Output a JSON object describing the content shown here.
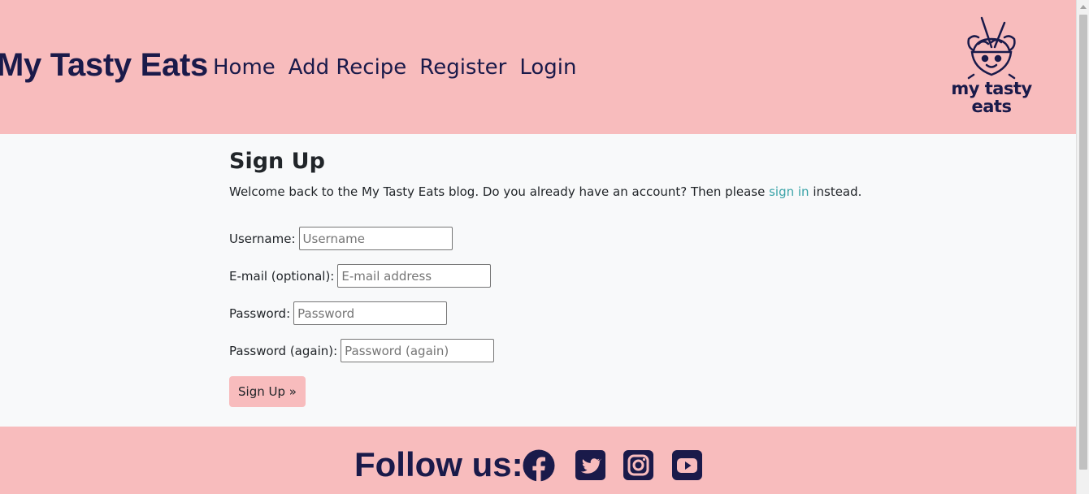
{
  "header": {
    "brand": "My Tasty Eats",
    "nav": [
      "Home",
      "Add Recipe",
      "Register",
      "Login"
    ],
    "logo_text_line1": "my tasty",
    "logo_text_line2": "eats"
  },
  "main": {
    "title": "Sign Up",
    "intro_before": "Welcome back to the My Tasty Eats blog. Do you already have an account? Then please ",
    "intro_link": "sign in",
    "intro_after": " instead.",
    "fields": [
      {
        "label": "Username:",
        "placeholder": "Username",
        "value": ""
      },
      {
        "label": "E-mail (optional):",
        "placeholder": "E-mail address",
        "value": ""
      },
      {
        "label": "Password:",
        "placeholder": "Password",
        "value": ""
      },
      {
        "label": "Password (again):",
        "placeholder": "Password (again)",
        "value": ""
      }
    ],
    "submit_label": "Sign Up »"
  },
  "footer": {
    "follow_text": "Follow us:",
    "icons": [
      "facebook-icon",
      "twitter-icon",
      "instagram-icon",
      "youtube-icon"
    ]
  },
  "colors": {
    "header_bg": "#f8bcbd",
    "navy": "#1a1a4a",
    "link": "#3aa3a8",
    "page_bg": "#f8f9fa"
  }
}
